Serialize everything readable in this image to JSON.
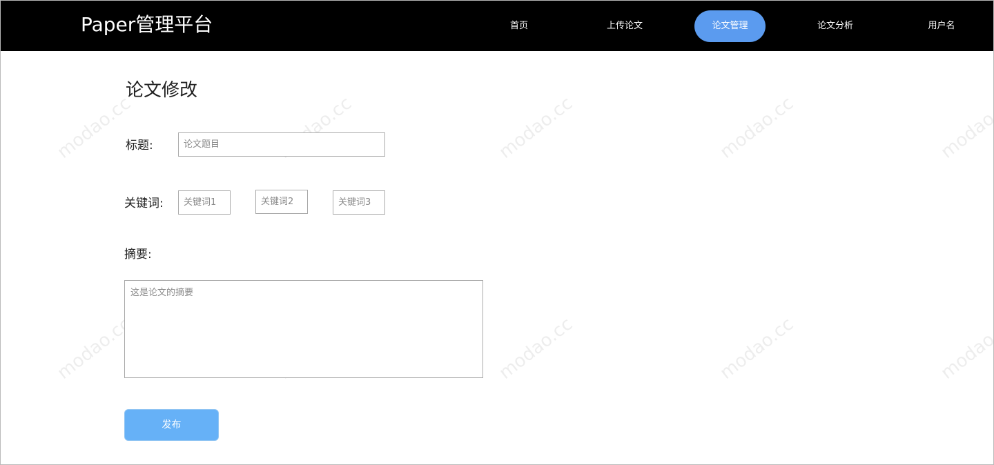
{
  "header": {
    "brand": "Paper管理平台",
    "nav": [
      {
        "label": "首页",
        "active": false
      },
      {
        "label": "上传论文",
        "active": false
      },
      {
        "label": "论文管理",
        "active": true
      },
      {
        "label": "论文分析",
        "active": false
      },
      {
        "label": "用户名",
        "active": false
      }
    ]
  },
  "main": {
    "title": "论文修改",
    "title_field": {
      "label": "标题:",
      "placeholder": "论文题目",
      "value": ""
    },
    "keywords": {
      "label": "关键词:",
      "inputs": [
        {
          "placeholder": "关键词1",
          "value": ""
        },
        {
          "placeholder": "关键词2",
          "value": ""
        },
        {
          "placeholder": "关键词3",
          "value": ""
        }
      ]
    },
    "abstract": {
      "label": "摘要:",
      "placeholder": "这是论文的摘要",
      "value": ""
    },
    "publish_label": "发布"
  },
  "watermark": "modao.cc",
  "colors": {
    "header_bg": "#000000",
    "nav_active": "#5b9bef",
    "publish_button": "#66b1f7"
  }
}
